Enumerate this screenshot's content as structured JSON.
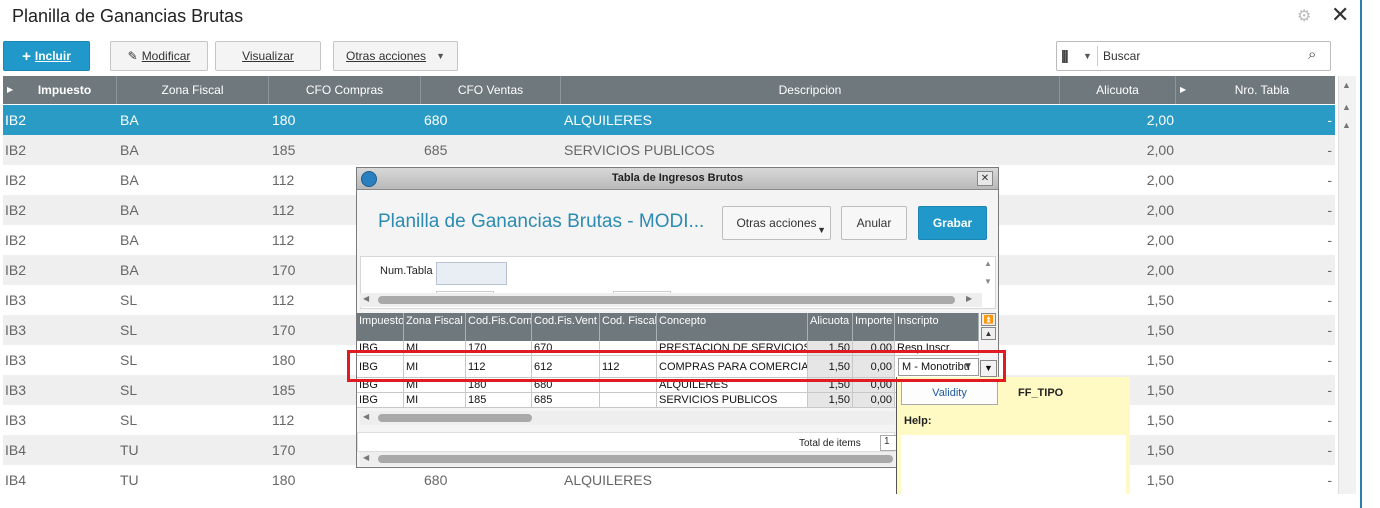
{
  "header": {
    "title": "Planilla de Ganancias Brutas"
  },
  "toolbar": {
    "incluir_label": "Incluir",
    "modificar_label": "Modificar",
    "visualizar_label": "Visualizar",
    "otras_label": "Otras acciones",
    "search_placeholder": "Buscar"
  },
  "grid": {
    "columns": [
      "Impuesto",
      "Zona Fiscal",
      "CFO Compras",
      "CFO Ventas",
      "Descripcion",
      "Alicuota",
      "Nro. Tabla"
    ],
    "rows": [
      {
        "impuesto": "IB2",
        "zona": "BA",
        "cfo_compras": "180",
        "cfo_ventas": "680",
        "descripcion": "ALQUILERES",
        "alicuota": "2,00",
        "nro": "-"
      },
      {
        "impuesto": "IB2",
        "zona": "BA",
        "cfo_compras": "185",
        "cfo_ventas": "685",
        "descripcion": "SERVICIOS PUBLICOS",
        "alicuota": "2,00",
        "nro": "-"
      },
      {
        "impuesto": "IB2",
        "zona": "BA",
        "cfo_compras": "112",
        "cfo_ventas": "",
        "descripcion": "",
        "alicuota": "2,00",
        "nro": "-"
      },
      {
        "impuesto": "IB2",
        "zona": "BA",
        "cfo_compras": "112",
        "cfo_ventas": "",
        "descripcion": "",
        "alicuota": "2,00",
        "nro": "-"
      },
      {
        "impuesto": "IB2",
        "zona": "BA",
        "cfo_compras": "112",
        "cfo_ventas": "",
        "descripcion": "",
        "alicuota": "2,00",
        "nro": "-"
      },
      {
        "impuesto": "IB2",
        "zona": "BA",
        "cfo_compras": "170",
        "cfo_ventas": "",
        "descripcion": "",
        "alicuota": "2,00",
        "nro": "-"
      },
      {
        "impuesto": "IB3",
        "zona": "SL",
        "cfo_compras": "112",
        "cfo_ventas": "",
        "descripcion": "",
        "alicuota": "1,50",
        "nro": "-"
      },
      {
        "impuesto": "IB3",
        "zona": "SL",
        "cfo_compras": "170",
        "cfo_ventas": "",
        "descripcion": "",
        "alicuota": "1,50",
        "nro": "-"
      },
      {
        "impuesto": "IB3",
        "zona": "SL",
        "cfo_compras": "180",
        "cfo_ventas": "",
        "descripcion": "",
        "alicuota": "1,50",
        "nro": "-"
      },
      {
        "impuesto": "IB3",
        "zona": "SL",
        "cfo_compras": "185",
        "cfo_ventas": "",
        "descripcion": "",
        "alicuota": "1,50",
        "nro": "-"
      },
      {
        "impuesto": "IB3",
        "zona": "SL",
        "cfo_compras": "112",
        "cfo_ventas": "",
        "descripcion": "",
        "alicuota": "1,50",
        "nro": "-"
      },
      {
        "impuesto": "IB4",
        "zona": "TU",
        "cfo_compras": "170",
        "cfo_ventas": "",
        "descripcion": "",
        "alicuota": "1,50",
        "nro": "-"
      },
      {
        "impuesto": "IB4",
        "zona": "TU",
        "cfo_compras": "180",
        "cfo_ventas": "680",
        "descripcion": "ALQUILERES",
        "alicuota": "1,50",
        "nro": "-"
      }
    ]
  },
  "dialog": {
    "title": "Tabla de Ingresos Brutos",
    "heading": "Planilla de Ganancias Brutas - MODI...",
    "otras_label": "Otras acciones",
    "anular_label": "Anular",
    "grabar_label": "Grabar",
    "num_tabla_label": "Num.Tabla",
    "columns": [
      "Impuesto",
      "Zona Fiscal",
      "Cod.Fis.Comp",
      "Cod.Fis.Vent",
      "Cod. Fiscal",
      "Concepto",
      "Alicuota",
      "Importe",
      "Inscripto"
    ],
    "rows": [
      {
        "impuesto": "IBG",
        "zona": "MI",
        "comp": "170",
        "vent": "670",
        "fiscal": "",
        "concepto": "PRESTACION DE SERVICIOS",
        "alicuota": "1,50",
        "importe": "0,00",
        "inscripto": "Resp.Inscr."
      },
      {
        "impuesto": "IBG",
        "zona": "MI",
        "comp": "112",
        "vent": "612",
        "fiscal": "112",
        "concepto": "COMPRAS PARA COMERCIAL",
        "alicuota": "1,50",
        "importe": "0,00",
        "inscripto": "M - Monotribu"
      },
      {
        "impuesto": "IBG",
        "zona": "MI",
        "comp": "180",
        "vent": "680",
        "fiscal": "",
        "concepto": "ALQUILERES",
        "alicuota": "1,50",
        "importe": "0,00",
        "inscripto": ""
      },
      {
        "impuesto": "IBG",
        "zona": "MI",
        "comp": "185",
        "vent": "685",
        "fiscal": "",
        "concepto": "SERVICIOS PUBLICOS",
        "alicuota": "1,50",
        "importe": "0,00",
        "inscripto": ""
      }
    ],
    "total_label": "Total de items",
    "total_value": "1"
  },
  "help": {
    "validity_label": "Validity",
    "field": "FF_TIPO",
    "help_label": "Help:"
  }
}
